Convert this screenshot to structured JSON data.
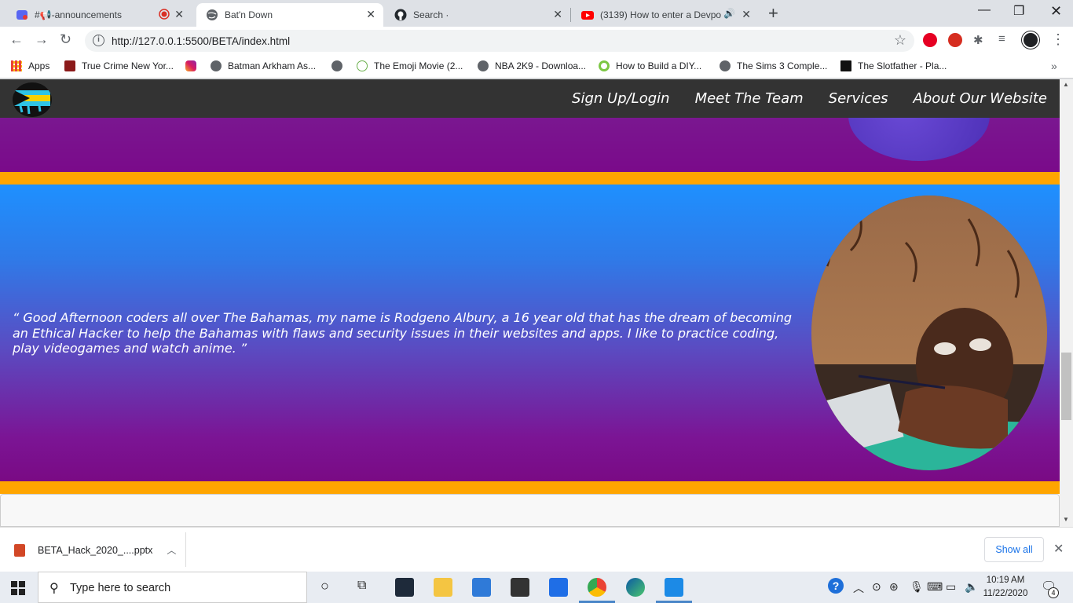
{
  "browser": {
    "tabs": [
      {
        "title": "#📢-announcements",
        "favicon": "discord-icon",
        "recording": true
      },
      {
        "title": "Bat'n Down",
        "favicon": "globe-icon",
        "active": true
      },
      {
        "title": "Search ·",
        "favicon": "github-icon"
      },
      {
        "title": "(3139) How to enter a Devpo",
        "favicon": "youtube-icon",
        "audio": true
      }
    ],
    "url": "http://127.0.0.1:5500/BETA/index.html",
    "bookmarks": [
      {
        "label": "Apps",
        "icon": "apps-grid-icon"
      },
      {
        "label": "True Crime New Yor...",
        "icon": "game-icon"
      },
      {
        "label": "",
        "icon": "instagram-icon"
      },
      {
        "label": "Batman Arkham As...",
        "icon": "globe-icon"
      },
      {
        "label": "",
        "icon": "globe-icon"
      },
      {
        "label": "The Emoji Movie (2...",
        "icon": "yts-icon"
      },
      {
        "label": "NBA 2K9 - Downloa...",
        "icon": "globe-icon"
      },
      {
        "label": "How to Build a DIY...",
        "icon": "green-ring-icon"
      },
      {
        "label": "The Sims 3 Comple...",
        "icon": "globe-icon"
      },
      {
        "label": "The Slotfather - Pla...",
        "icon": "vso-icon"
      }
    ]
  },
  "site": {
    "nav": [
      "Sign Up/Login",
      "Meet The Team",
      "Services",
      "About Our Website"
    ],
    "quote": "“ Good Afternoon coders all over The Bahamas, my name is Rodgeno Albury, a 16 year old that has the dream of becoming an Ethical Hacker to help the Bahamas with flaws and security issues in their websites and apps. I like to practice coding, play videogames and watch anime. ”",
    "colors": {
      "navbar": "#333333",
      "stripe": "#ffa500",
      "purple": "#7a0a8a",
      "blue": "#1e90ff"
    }
  },
  "downloads": {
    "file": "BETA_Hack_2020_....pptx",
    "show_all": "Show all"
  },
  "taskbar": {
    "search_placeholder": "Type here to search",
    "time": "10:19 AM",
    "date": "11/22/2020",
    "notifications": "4"
  }
}
